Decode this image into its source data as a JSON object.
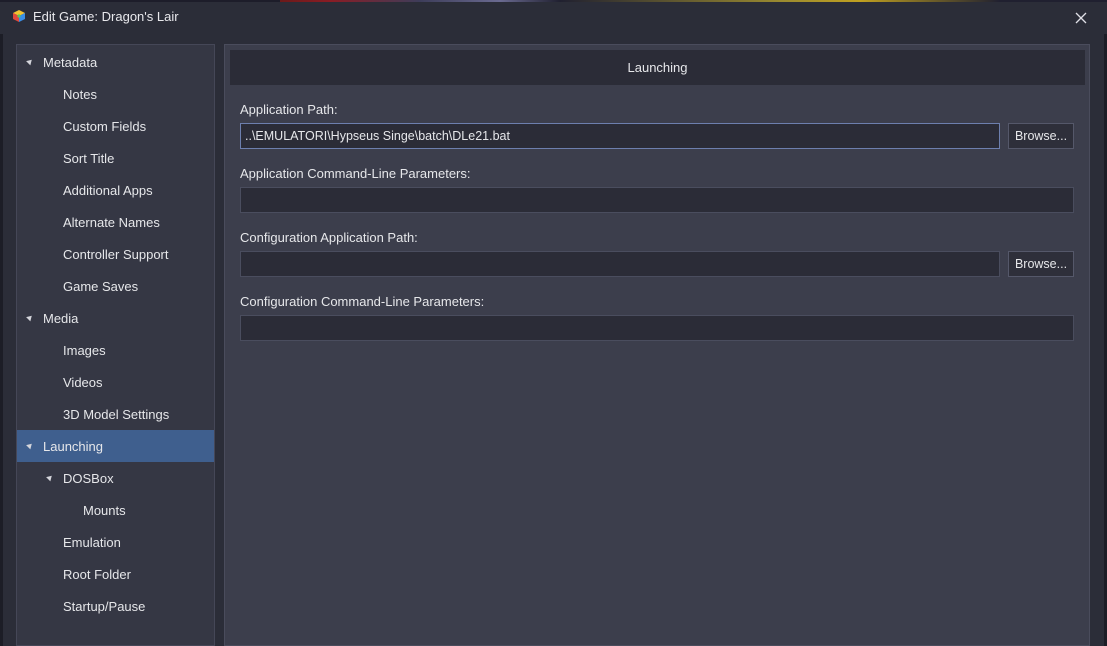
{
  "window": {
    "title": "Edit Game: Dragon's Lair",
    "app_icon": "cube-colorful-icon",
    "close_icon": "close-icon"
  },
  "sidebar": {
    "items": [
      {
        "label": "Metadata",
        "expanded": true
      },
      {
        "label": "Notes"
      },
      {
        "label": "Custom Fields"
      },
      {
        "label": "Sort Title"
      },
      {
        "label": "Additional Apps"
      },
      {
        "label": "Alternate Names"
      },
      {
        "label": "Controller Support"
      },
      {
        "label": "Game Saves"
      },
      {
        "label": "Media",
        "expanded": true
      },
      {
        "label": "Images"
      },
      {
        "label": "Videos"
      },
      {
        "label": "3D Model Settings"
      },
      {
        "label": "Launching",
        "expanded": true,
        "selected": true
      },
      {
        "label": "DOSBox",
        "expanded": true
      },
      {
        "label": "Mounts"
      },
      {
        "label": "Emulation"
      },
      {
        "label": "Root Folder"
      },
      {
        "label": "Startup/Pause"
      }
    ]
  },
  "main": {
    "header": "Launching",
    "fields": {
      "app_path": {
        "label": "Application Path:",
        "value": "..\\EMULATORI\\Hypseus Singe\\batch\\DLe21.bat"
      },
      "app_params": {
        "label": "Application Command-Line Parameters:",
        "value": ""
      },
      "config_path": {
        "label": "Configuration Application Path:",
        "value": ""
      },
      "config_params": {
        "label": "Configuration Command-Line Parameters:",
        "value": ""
      }
    },
    "browse_label": "Browse..."
  },
  "colors": {
    "background": "#2b2d38",
    "sidebar_bg": "#353744",
    "panel_bg": "#3c3e4c",
    "selected": "#3f5f8e",
    "input_bg": "#2b2c37",
    "focus_border": "#6d7fae"
  }
}
